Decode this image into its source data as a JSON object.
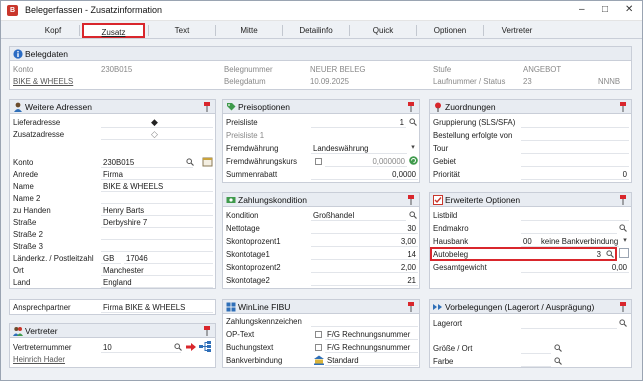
{
  "window": {
    "title": "Belegerfassen - Zusatzinformation",
    "app_icon": "B",
    "minimize": "–",
    "maximize": "□",
    "close": "✕"
  },
  "tabs": [
    "Kopf",
    "Zusatz",
    "Text",
    "Mitte",
    "Detailinfo",
    "Quick",
    "Optionen",
    "Vertreter"
  ],
  "belegdaten": {
    "title": "Belegdaten",
    "konto_label": "Konto",
    "konto_value": "230B015",
    "name_link": "BIKE & WHEELS",
    "belegnummer_label": "Belegnummer",
    "belegnummer_value": "NEUER BELEG",
    "belegdatum_label": "Belegdatum",
    "belegdatum_value": "10.09.2025",
    "stufe_label": "Stufe",
    "stufe_value": "ANGEBOT",
    "laufnummer_label": "Laufnummer / Status",
    "laufnummer_value": "23",
    "status_value": "NNNB"
  },
  "adressen": {
    "title": "Weitere Adressen",
    "lieferadresse": "Lieferadresse",
    "zusatzadresse": "Zusatzadresse",
    "konto_label": "Konto",
    "konto_value": "230B015",
    "anrede_label": "Anrede",
    "anrede_value": "Firma",
    "name_label": "Name",
    "name_value": "BIKE & WHEELS",
    "name2_label": "Name 2",
    "zuhanden_label": "zu Handen",
    "zuhanden_value": "Henry Barts",
    "strasse_label": "Straße",
    "strasse_value": "Derbyshire 7",
    "strasse2_label": "Straße 2",
    "strasse3_label": "Straße 3",
    "laender_label": "Länderkz. / Postleitzahl",
    "laender_value": "GB",
    "plz_value": "17046",
    "ort_label": "Ort",
    "ort_value": "Manchester",
    "land_label": "Land",
    "land_value": "England",
    "ansprech_label": "Ansprechpartner",
    "ansprech_value": "Firma BIKE & WHEELS"
  },
  "vertreter": {
    "title": "Vertreter",
    "nummer_label": "Vertreternummer",
    "nummer_value": "10",
    "name_link": "Heinrich Hader"
  },
  "preisoptionen": {
    "title": "Preisoptionen",
    "preisliste_label": "Preisliste",
    "preisliste_value": "1",
    "preisliste1": "Preisliste 1",
    "fremdw_label": "Fremdwährung",
    "fremdw_value": "Landeswährung",
    "fremdkurs_label": "Fremdwährungskurs",
    "fremdkurs_value": "0,000000",
    "summen_label": "Summenrabatt",
    "summen_value": "0,0000"
  },
  "zahlung": {
    "title": "Zahlungskondition",
    "kondition_label": "Kondition",
    "kondition_value": "Großhandel",
    "nettotage_label": "Nettotage",
    "nettotage_value": "30",
    "skp1_label": "Skontoprozent1",
    "skp1_value": "3,00",
    "skt1_label": "Skontotage1",
    "skt1_value": "14",
    "skp2_label": "Skontoprozent2",
    "skp2_value": "2,00",
    "skt2_label": "Skontotage2",
    "skt2_value": "21"
  },
  "fibu": {
    "title": "WinLine FIBU",
    "zk_label": "Zahlungskennzeichen",
    "op_label": "OP-Text",
    "op_value": "F/G Rechnungsnummer",
    "buch_label": "Buchungstext",
    "buch_value": "F/G Rechnungsnummer",
    "bank_label": "Bankverbindung",
    "bank_value": "Standard"
  },
  "zuordnungen": {
    "title": "Zuordnungen",
    "gruppierung": "Gruppierung (SLS/SFA)",
    "bestellung": "Bestellung erfolgte von",
    "tour": "Tour",
    "gebiet": "Gebiet",
    "prioritaet_label": "Priorität",
    "prioritaet_value": "0"
  },
  "erweitert": {
    "title": "Erweiterte Optionen",
    "listbild": "Listbild",
    "endmakro": "Endmakro",
    "hausbank_label": "Hausbank",
    "hausbank_value": "00",
    "hausbank_text": "keine Bankverbindung",
    "autobeleg_label": "Autobeleg",
    "autobeleg_value": "3",
    "gesamtgewicht_label": "Gesamtgewicht",
    "gesamtgewicht_value": "0,00"
  },
  "vorbelegungen": {
    "title": "Vorbelegungen (Lagerort / Ausprägung)",
    "lagerort": "Lagerort",
    "groesse": "Größe / Ort",
    "farbe": "Farbe"
  },
  "colors": {
    "highlight": "#d9262c",
    "panel_header": "#e8ecf2",
    "link": "#555555"
  }
}
